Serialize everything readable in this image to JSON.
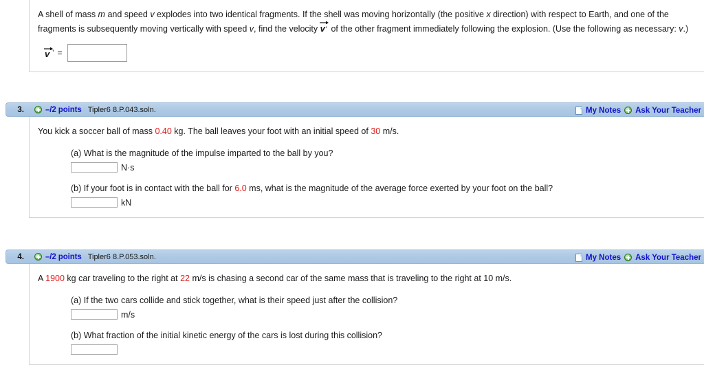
{
  "colors": {
    "header_blue": "#aec9e4",
    "link_blue": "#1414c8",
    "value_red": "#e01b1b",
    "border_gray": "#d4d4d4"
  },
  "questions": [
    {
      "id": "q-partial-top",
      "has_header": false,
      "stem_parts": [
        {
          "t": "A shell of mass ",
          "style": "plain"
        },
        {
          "t": "m",
          "style": "italic"
        },
        {
          "t": " and speed ",
          "style": "plain"
        },
        {
          "t": "v",
          "style": "italic"
        },
        {
          "t": " explodes into two identical fragments. If the shell was moving horizontally (the positive ",
          "style": "plain"
        },
        {
          "t": "x",
          "style": "italic"
        },
        {
          "t": " direction) with respect to Earth, and one of the fragments is subsequently moving vertically with speed ",
          "style": "plain"
        },
        {
          "t": "v",
          "style": "italic"
        },
        {
          "t": ", find the velocity ",
          "style": "plain"
        },
        {
          "t": "VEC",
          "style": "vector"
        },
        {
          "t": " of the other fragment immediately following the explosion. (Use the following as necessary: ",
          "style": "plain"
        },
        {
          "t": "v",
          "style": "italic"
        },
        {
          "t": ".)",
          "style": "plain"
        }
      ],
      "vector_label": "v",
      "vector_prime": "'",
      "equals": "=",
      "answer_value": "",
      "answer_placeholder": ""
    },
    {
      "id": "q3",
      "has_header": true,
      "number": "3.",
      "points": "–/2 points",
      "code": "Tipler6 8.P.043.soln.",
      "notes_label": "My Notes",
      "teacher_label": "Ask Your Teacher",
      "stem_parts": [
        {
          "t": "You kick a soccer ball of mass ",
          "style": "plain"
        },
        {
          "t": "0.40",
          "style": "red"
        },
        {
          "t": " kg. The ball leaves your foot with an initial speed of ",
          "style": "plain"
        },
        {
          "t": "30",
          "style": "red"
        },
        {
          "t": " m/s.",
          "style": "plain"
        }
      ],
      "parts": [
        {
          "label_parts": [
            {
              "t": "(a) What is the magnitude of the impulse imparted to the ball by you?",
              "style": "plain"
            }
          ],
          "answer_value": "",
          "unit": "N·s"
        },
        {
          "label_parts": [
            {
              "t": "(b) If your foot is in contact with the ball for ",
              "style": "plain"
            },
            {
              "t": "6.0",
              "style": "red"
            },
            {
              "t": " ms, what is the magnitude of the average force exerted by your foot on the ball?",
              "style": "plain"
            }
          ],
          "answer_value": "",
          "unit": "kN"
        }
      ]
    },
    {
      "id": "q4",
      "has_header": true,
      "number": "4.",
      "points": "–/2 points",
      "code": "Tipler6 8.P.053.soln.",
      "notes_label": "My Notes",
      "teacher_label": "Ask Your Teacher",
      "stem_parts": [
        {
          "t": "A ",
          "style": "plain"
        },
        {
          "t": "1900",
          "style": "red"
        },
        {
          "t": " kg car traveling to the right at ",
          "style": "plain"
        },
        {
          "t": "22",
          "style": "red"
        },
        {
          "t": " m/s is chasing a second car of the same mass that is traveling to the right at 10 m/s.",
          "style": "plain"
        }
      ],
      "parts": [
        {
          "label_parts": [
            {
              "t": "(a) If the two cars collide and stick together, what is their speed just after the collision?",
              "style": "plain"
            }
          ],
          "answer_value": "",
          "unit": "m/s"
        },
        {
          "label_parts": [
            {
              "t": "(b) What fraction of the initial kinetic energy of the cars is lost during this collision?",
              "style": "plain"
            }
          ],
          "answer_value": "",
          "unit": ""
        }
      ]
    }
  ]
}
